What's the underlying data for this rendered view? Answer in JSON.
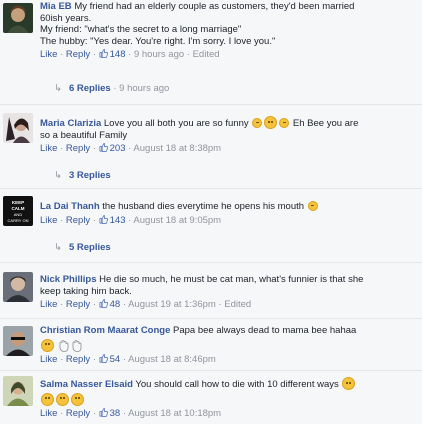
{
  "common": {
    "like_label": "Like",
    "reply_label": "Reply",
    "dot": " · "
  },
  "comments": [
    {
      "author": "Mia EB",
      "lines": [
        "My friend had an elderly couple as customers, they'd been married",
        "60ish years.",
        "My friend: \"what's the secret to a long marriage\"",
        "The hubby: \"Yes dear. You're right. I'm sorry. I love you.\""
      ],
      "likes": "148",
      "time": "9 hours ago",
      "edited": "Edited",
      "replies": {
        "label": "6 Replies",
        "time": "9 hours ago"
      }
    },
    {
      "author": "Maria Clarizia",
      "text_a": "Love you all both you are so funny",
      "text_b": "Eh Bee you are",
      "text_c": "so a beautiful Family",
      "likes": "203",
      "time": "August 18 at 8:38pm",
      "replies": {
        "label": "3 Replies"
      }
    },
    {
      "author": "La Dai Thanh",
      "text": "the husband dies everytime he opens his mouth",
      "likes": "143",
      "time": "August 18 at 9:05pm",
      "replies": {
        "label": "5 Replies"
      }
    },
    {
      "author": "Nick Phillips",
      "text_a": "He die so much, he must be cat man, what's funnier is that she",
      "text_b": "keep taking him back.",
      "likes": "48",
      "time": "August 19 at 1:36pm",
      "edited": "Edited"
    },
    {
      "author": "Christian Rom Maarat Conge",
      "text": "Papa bee always dead to mama bee hahaa",
      "likes": "54",
      "time": "August 18 at 8:46pm"
    },
    {
      "author": "Salma Nasser Elsaid",
      "text": "You should call how to die with 10 different ways",
      "likes": "38",
      "time": "August 18 at 10:18pm"
    }
  ]
}
